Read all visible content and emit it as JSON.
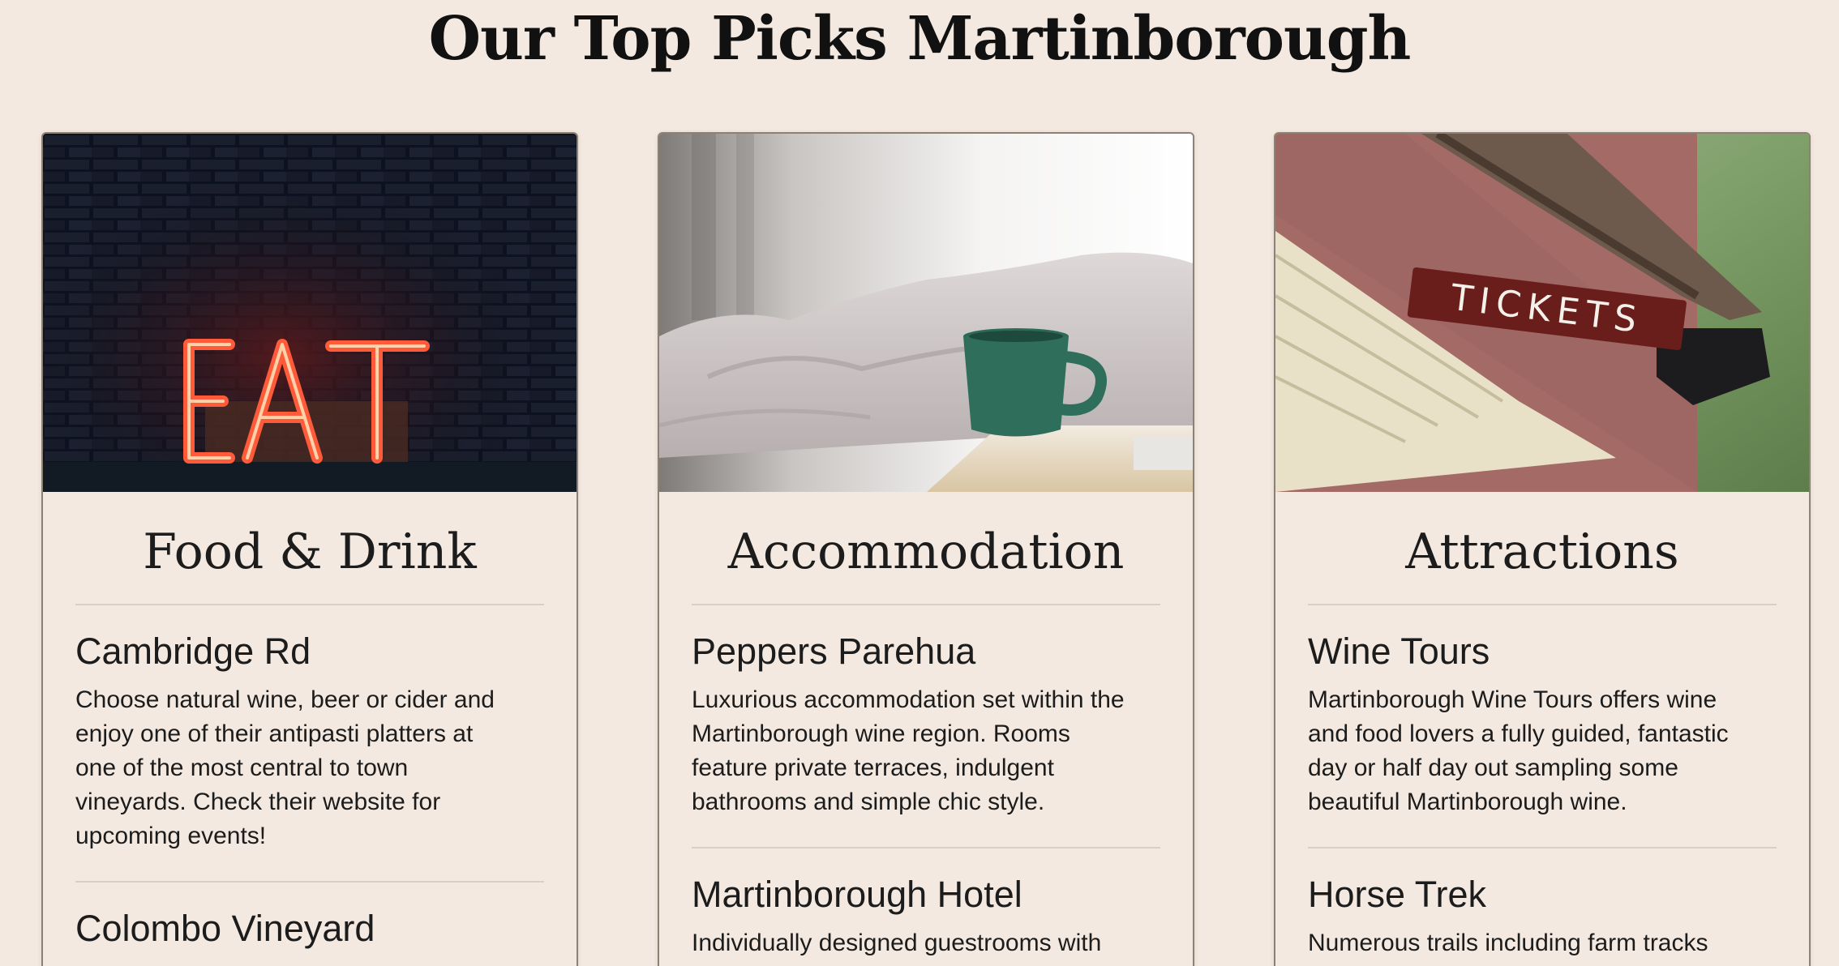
{
  "page": {
    "title": "Our Top Picks Martinborough"
  },
  "cards": [
    {
      "heading": "Food & Drink",
      "image": "eat-neon-sign-photo",
      "items": [
        {
          "title": "Cambridge Rd",
          "description_lines": [
            "Choose natural wine, beer or cider and",
            "enjoy one of their antipasti platters at",
            "one of the most central to town",
            "vineyards. Check their website for",
            "upcoming events!"
          ]
        },
        {
          "title": "Colombo Vineyard",
          "description_lines": []
        }
      ]
    },
    {
      "heading": "Accommodation",
      "image": "bed-and-coffee-mug-photo",
      "items": [
        {
          "title": "Peppers Parehua",
          "description_lines": [
            "Luxurious accommodation set within the",
            "Martinborough wine region. Rooms",
            "feature private terraces, indulgent",
            "bathrooms and simple chic style."
          ]
        },
        {
          "title": "Martinborough Hotel",
          "description_lines": [
            "Individually designed guestrooms with"
          ]
        }
      ]
    },
    {
      "heading": "Attractions",
      "image": "tickets-sign-photo",
      "image_sign_text": "TICKETS",
      "items": [
        {
          "title": "Wine Tours",
          "description_lines": [
            "Martinborough Wine Tours offers wine",
            "and food lovers a fully guided, fantastic",
            "day or half day out sampling some",
            "beautiful Martinborough wine."
          ]
        },
        {
          "title": "Horse Trek",
          "description_lines": [
            "Numerous trails including farm tracks"
          ]
        }
      ]
    }
  ],
  "colors": {
    "page_background": "#f3e9e0",
    "card_border": "#8d8173",
    "divider": "#d9cfc5",
    "text": "#1c1c1c"
  }
}
